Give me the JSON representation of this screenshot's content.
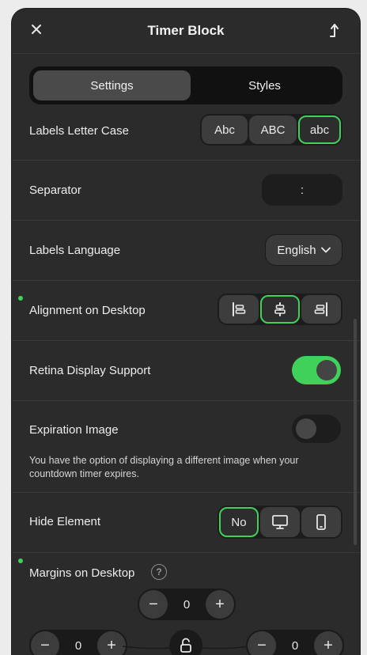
{
  "header": {
    "title": "Timer Block"
  },
  "tabs": [
    {
      "label": "Settings"
    },
    {
      "label": "Styles"
    }
  ],
  "labels_letter_case": {
    "label": "Labels Letter Case",
    "options": [
      "Abc",
      "ABC",
      "abc"
    ],
    "selected": "abc"
  },
  "separator": {
    "label": "Separator",
    "value": ":"
  },
  "labels_language": {
    "label": "Labels Language",
    "value": "English"
  },
  "alignment": {
    "label": "Alignment on Desktop",
    "selected": "center"
  },
  "retina": {
    "label": "Retina Display Support",
    "enabled": true
  },
  "expiration": {
    "label": "Expiration Image",
    "enabled": false,
    "description": "You have the option of displaying a different image when your countdown timer expires."
  },
  "hide_element": {
    "label": "Hide Element",
    "no_label": "No",
    "selected": "No"
  },
  "margins": {
    "label": "Margins on Desktop",
    "help": "?",
    "top": "0",
    "left": "0",
    "right": "0"
  },
  "colors": {
    "accent": "#3fd15a",
    "panel": "#2b2b2b"
  }
}
